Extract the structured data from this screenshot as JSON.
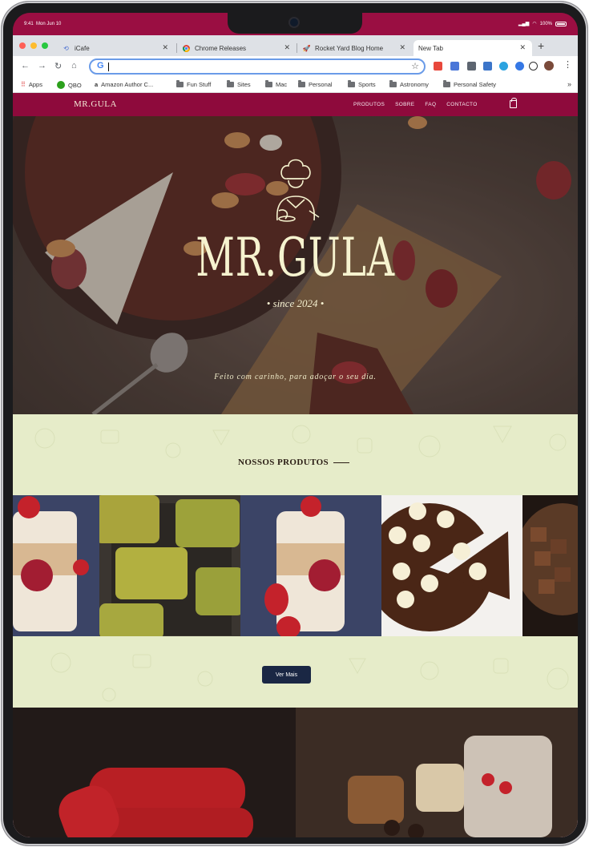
{
  "statusbar": {
    "time": "9:41",
    "date": "Mon Jun 10",
    "battery": "100%"
  },
  "browser": {
    "tabs": [
      {
        "label": "iCafe",
        "icon": "icafe-icon"
      },
      {
        "label": "Chrome Releases",
        "icon": "chrome-icon"
      },
      {
        "label": "Rocket Yard Blog Home",
        "icon": "rocket-icon"
      },
      {
        "label": "New Tab",
        "icon": "none",
        "active": true
      }
    ],
    "address": {
      "value": "",
      "placeholder": ""
    },
    "bookmarks": [
      {
        "label": "Apps",
        "icon": "apps-grid-icon"
      },
      {
        "label": "QBO",
        "icon": "qbo-icon"
      },
      {
        "label": "Amazon Author C...",
        "icon": "amazon-icon"
      },
      {
        "label": "Fun Stuff",
        "icon": "folder-icon"
      },
      {
        "label": "Sites",
        "icon": "folder-icon"
      },
      {
        "label": "Mac",
        "icon": "folder-icon"
      },
      {
        "label": "Personal",
        "icon": "folder-icon"
      },
      {
        "label": "Sports",
        "icon": "folder-icon"
      },
      {
        "label": "Astronomy",
        "icon": "folder-icon"
      },
      {
        "label": "Personal Safety",
        "icon": "folder-icon"
      }
    ]
  },
  "site": {
    "logo": "MR.GULA",
    "menu": [
      "PRODUTOS",
      "SOBRE",
      "FAQ",
      "CONTACTO"
    ],
    "hero": {
      "title": "MR.GULA",
      "subtitle": "• since 2024 •",
      "tagline": "Feito com carinho, para adoçar o seu dia."
    },
    "products": {
      "title": "NOSSOS PRODUTOS",
      "button": "Ver Mais",
      "items": [
        "strawberry-cup-dessert",
        "pistachio-bars",
        "strawberry-cup-dessert-2",
        "banana-chocolate-pizza",
        "chocolate-brownie-bites"
      ]
    }
  },
  "colors": {
    "brand": "#8e0a3c",
    "cream": "#e6ecc9",
    "button": "#1a2744",
    "title": "#f6f3cf"
  }
}
